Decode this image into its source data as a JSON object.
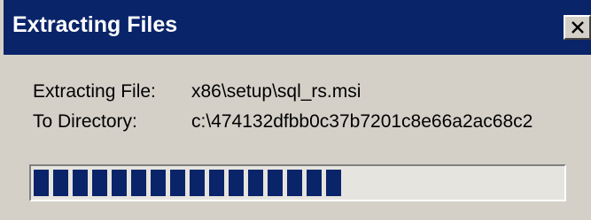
{
  "window": {
    "title": "Extracting Files"
  },
  "details": {
    "file_label": "Extracting File:",
    "file_value": "x86\\setup\\sql_rs.msi",
    "dir_label": "To Directory:",
    "dir_value": "c:\\474132dfbb0c37b7201c8e66a2ac68c2"
  },
  "progress": {
    "blocks_filled": 16,
    "fraction": 0.6,
    "color": "#0a246a"
  },
  "icons": {
    "close": "close-icon"
  }
}
